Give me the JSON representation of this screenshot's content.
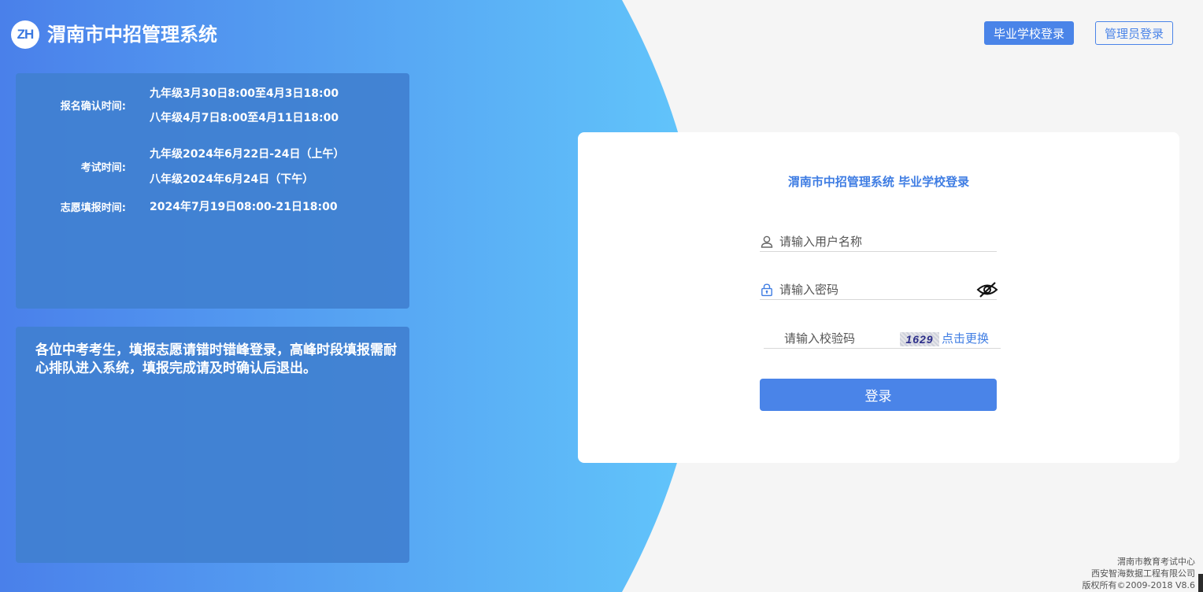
{
  "header": {
    "logo_text": "ZH",
    "app_title": "渭南市中招管理系统",
    "school_login_label": "毕业学校登录",
    "admin_login_label": "管理员登录"
  },
  "schedule": {
    "confirm_label": "报名确认时间:",
    "confirm_values": [
      "九年级3月30日8:00至4月3日18:00",
      "八年级4月7日8:00至4月11日18:00"
    ],
    "exam_label": "考试时间:",
    "exam_values": [
      "九年级2024年6月22日-24日（上午）",
      "八年级2024年6月24日（下午）"
    ],
    "choice_label": "志愿填报时间:",
    "choice_value": "2024年7月19日08:00-21日18:00"
  },
  "notice": {
    "text": "各位中考考生，填报志愿请错时错峰登录，高峰时段填报需耐心排队进入系统，填报完成请及时确认后退出。"
  },
  "login": {
    "title": "渭南市中招管理系统 毕业学校登录",
    "username_placeholder": "请输入用户名称",
    "password_placeholder": "请输入密码",
    "captcha_placeholder": "请输入校验码",
    "captcha_code": "1629",
    "captcha_refresh_label": "点击更换",
    "submit_label": "登录"
  },
  "footer": {
    "line1": "渭南市教育考试中心",
    "line2": "西安智海数据工程有限公司",
    "line3": "版权所有©2009-2018 V8.6"
  },
  "colors": {
    "brand_blue": "#4a84e8",
    "gradient_start": "#4a80ea",
    "gradient_end": "#62c6fb",
    "page_bg": "#f5f5f5"
  },
  "icons": {
    "user_field": "user-icon",
    "password_field": "lock-icon",
    "password_toggle": "eye-off-icon"
  }
}
